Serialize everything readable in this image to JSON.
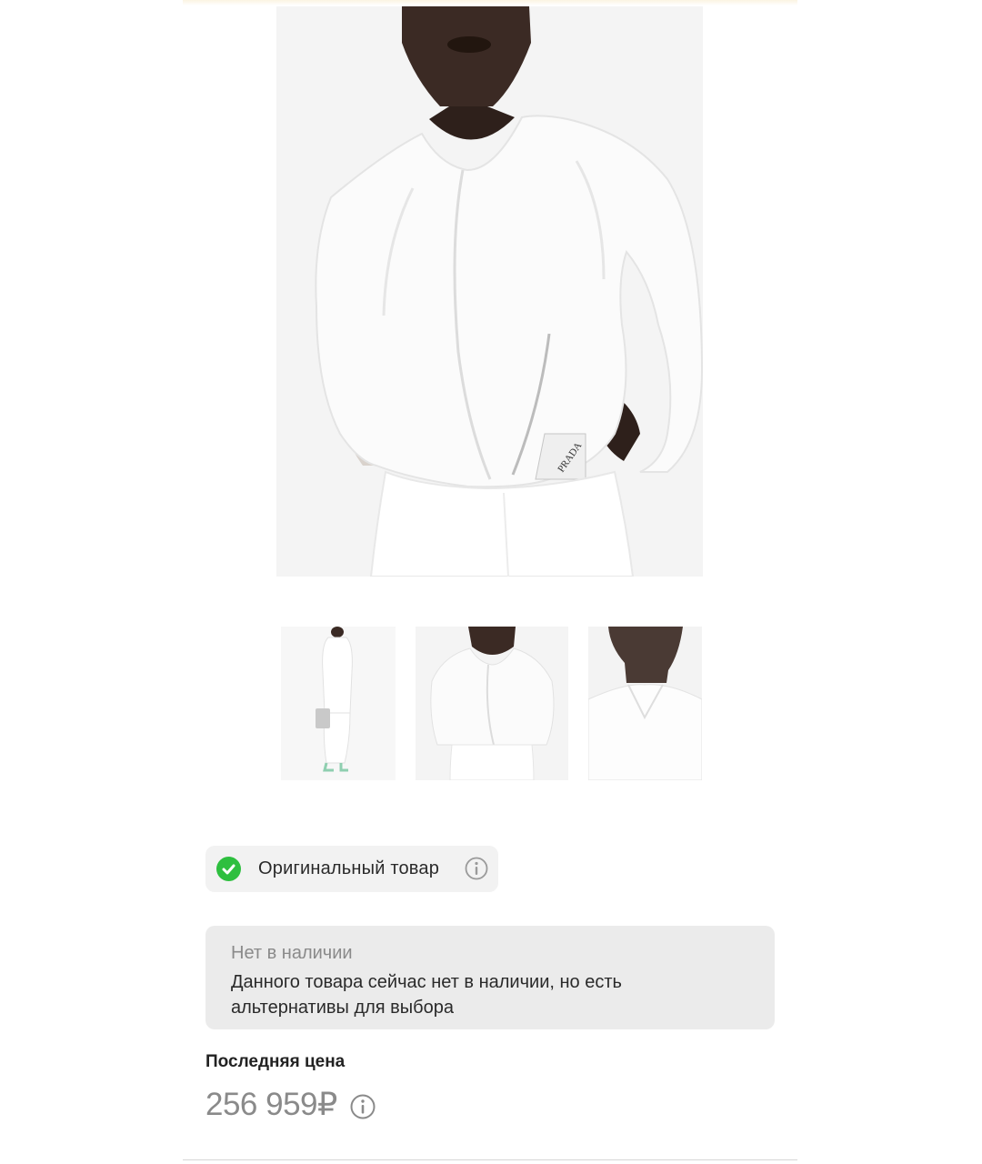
{
  "product": {
    "main_image_alt": "",
    "thumbnails": [
      "",
      "",
      ""
    ],
    "brand_print": "PRADA"
  },
  "authenticity": {
    "label": "Оригинальный товар"
  },
  "stock": {
    "title": "Нет в наличии",
    "message": "Данного товара сейчас нет в наличии, но есть альтернативы для выбора"
  },
  "price": {
    "label": "Последняя цена",
    "value": "256 959₽"
  },
  "colors": {
    "check_green": "#2ebf3f",
    "muted_text": "#8a8a8a",
    "badge_bg": "#f2f2f2",
    "stock_bg": "#ebebeb"
  },
  "icons": {
    "check": "check-circle-icon",
    "info": "info-icon"
  }
}
